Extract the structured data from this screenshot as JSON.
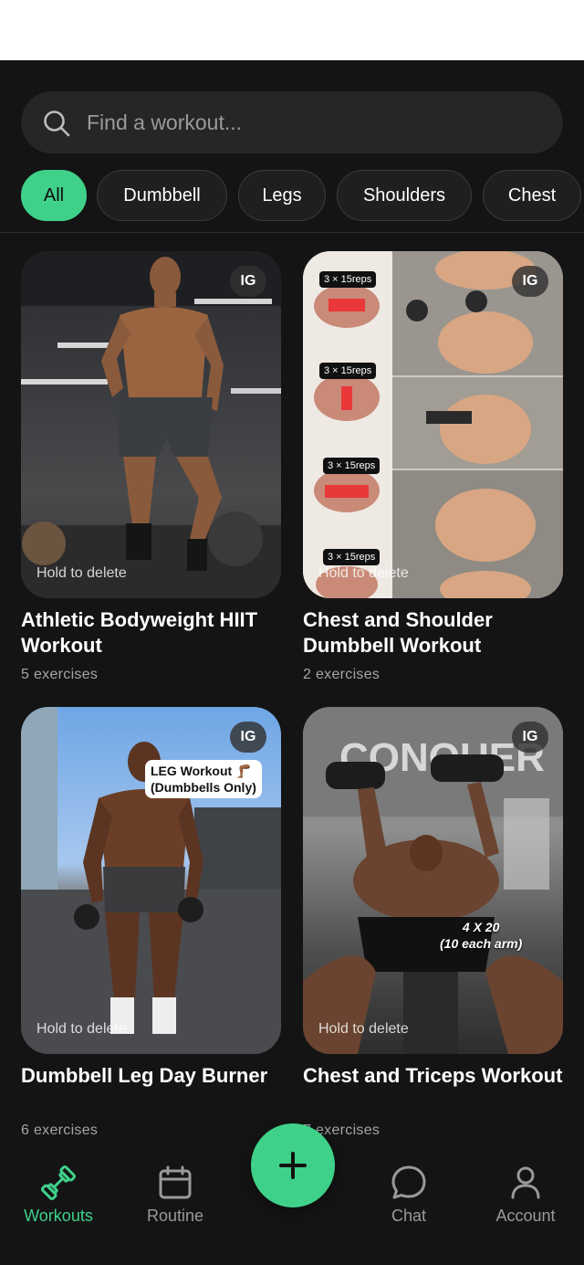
{
  "search": {
    "placeholder": "Find a workout..."
  },
  "filters": [
    "All",
    "Dumbbell",
    "Legs",
    "Shoulders",
    "Chest"
  ],
  "cards": [
    {
      "title": "Athletic Bodyweight HIIT Workout",
      "exercises": "5 exercises",
      "badge": "IG",
      "hold": "Hold to delete"
    },
    {
      "title": "Chest and Shoulder Dumbbell Workout",
      "exercises": "2 exercises",
      "badge": "IG",
      "hold": "Hold to delete",
      "overlay_labels": [
        "3 × 15reps",
        "3 × 15reps",
        "3 × 15reps",
        "3 × 15reps"
      ]
    },
    {
      "title": "Dumbbell Leg Day Burner",
      "exercises": "6 exercises",
      "badge": "IG",
      "hold": "Hold to delete",
      "overlay_text": [
        "LEG Workout 🦵🏾",
        "(Dumbbells Only)"
      ]
    },
    {
      "title": "Chest and Triceps Workout",
      "exercises": "7 exercises",
      "badge": "IG",
      "hold": "Hold to delete",
      "overlay_text": [
        "4 X 20",
        "(10 each arm)"
      ]
    }
  ],
  "nav": {
    "workouts": "Workouts",
    "routine": "Routine",
    "chat": "Chat",
    "account": "Account",
    "add": "+"
  },
  "colors": {
    "accent": "#3fd18a",
    "background": "#141414",
    "chip_bg": "#1f1f1f"
  }
}
